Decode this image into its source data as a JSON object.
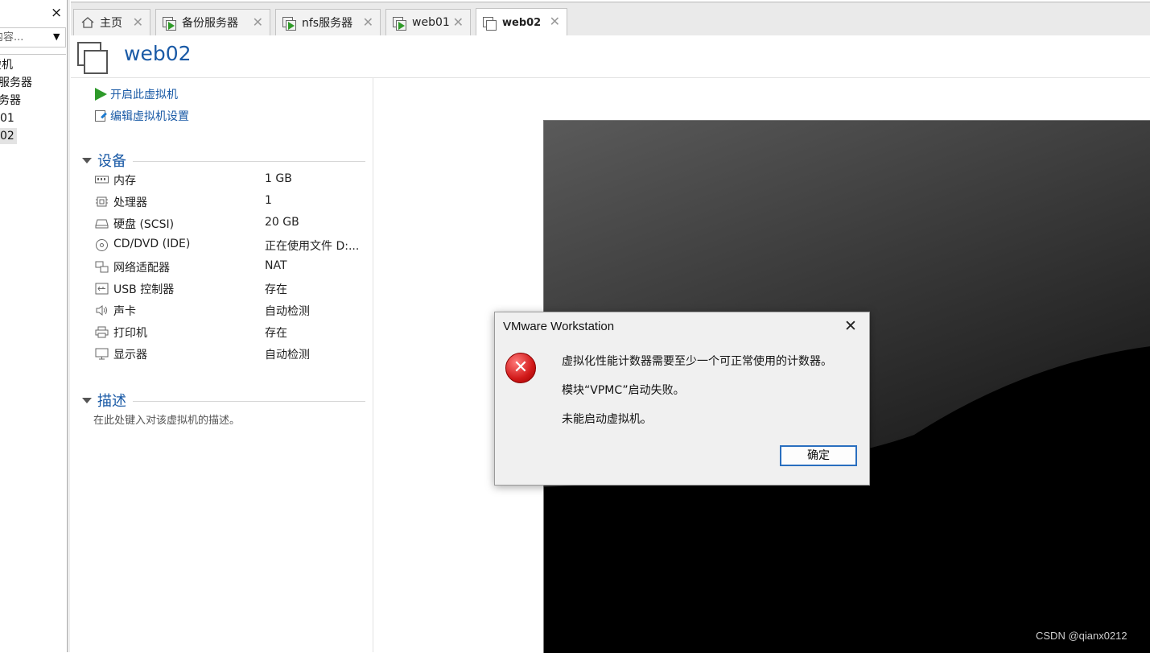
{
  "library": {
    "close_glyph": "×",
    "search_placeholder": "入内容...",
    "dropdown_glyph": "▼",
    "tree_items": [
      "虚机",
      "服务器",
      "务器",
      "01",
      "02"
    ]
  },
  "tabs": [
    {
      "label": "主页",
      "icon": "home-icon",
      "active": false
    },
    {
      "label": "备份服务器",
      "icon": "vm-running-icon",
      "active": false
    },
    {
      "label": "nfs服务器",
      "icon": "vm-running-icon",
      "active": false
    },
    {
      "label": "web01",
      "icon": "vm-running-icon",
      "active": false
    },
    {
      "label": "web02",
      "icon": "vm-icon",
      "active": true
    }
  ],
  "tab_close_glyph": "✕",
  "vm": {
    "title": "web02",
    "actions": {
      "power_on": "开启此虚拟机",
      "edit_settings": "编辑虚拟机设置"
    }
  },
  "devices_section": {
    "title": "设备",
    "items": [
      {
        "name": "内存",
        "value": "1 GB",
        "icon": "memory-icon"
      },
      {
        "name": "处理器",
        "value": "1",
        "icon": "processor-icon"
      },
      {
        "name": "硬盘 (SCSI)",
        "value": "20 GB",
        "icon": "hard-disk-icon"
      },
      {
        "name": "CD/DVD (IDE)",
        "value": "正在使用文件 D:...",
        "icon": "cd-dvd-icon"
      },
      {
        "name": "网络适配器",
        "value": "NAT",
        "icon": "network-adapter-icon"
      },
      {
        "name": "USB 控制器",
        "value": "存在",
        "icon": "usb-icon"
      },
      {
        "name": "声卡",
        "value": "自动检测",
        "icon": "speaker-icon"
      },
      {
        "name": "打印机",
        "value": "存在",
        "icon": "printer-icon"
      },
      {
        "name": "显示器",
        "value": "自动检测",
        "icon": "monitor-icon"
      }
    ]
  },
  "description_section": {
    "title": "描述",
    "placeholder": "在此处键入对该虚拟机的描述。"
  },
  "dialog": {
    "title": "VMware Workstation",
    "close_glyph": "✕",
    "error_glyph": "✕",
    "messages": [
      "虚拟化性能计数器需要至少一个可正常使用的计数器。",
      "模块“VPMC”启动失败。",
      "未能启动虚拟机。"
    ],
    "ok_label": "确定"
  },
  "watermark": "CSDN @qianx0212",
  "colors": {
    "accent": "#1a5aa6",
    "play_green": "#2e9a2a",
    "error_red": "#d11919",
    "console_bg": "#000000"
  }
}
